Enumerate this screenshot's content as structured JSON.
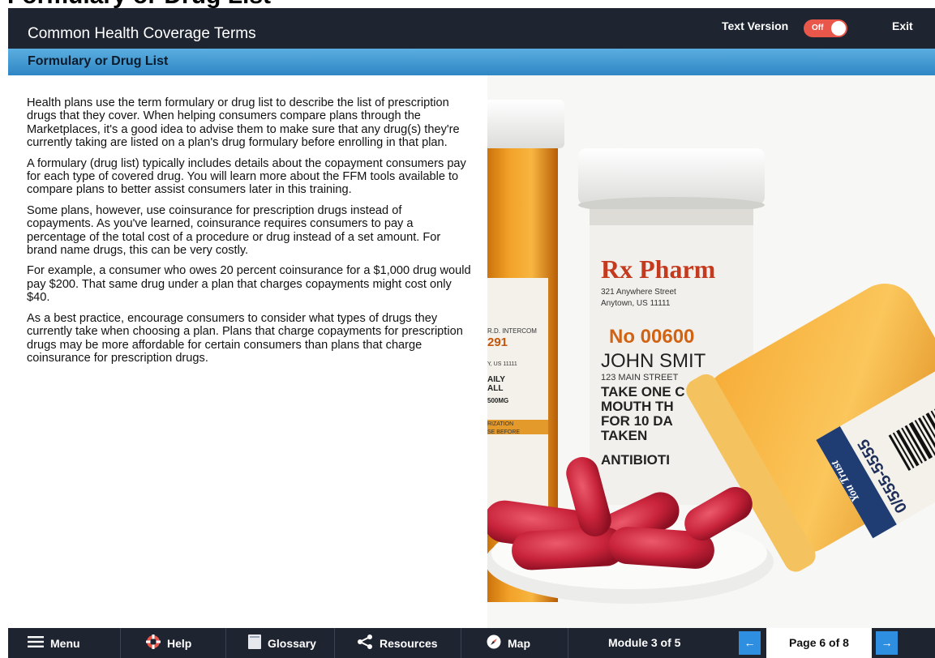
{
  "page_heading": "Formulary or Drug List",
  "header": {
    "title": "Common Health Coverage Terms",
    "text_version_label": "Text Version",
    "toggle_state": "Off",
    "exit_label": "Exit"
  },
  "subheader": {
    "title": "Formulary or Drug List"
  },
  "body": {
    "paragraphs": [
      "Health plans use the term formulary or drug list to describe the list of prescription drugs that they cover. When helping consumers compare plans through the Marketplaces, it's a good idea to advise them to make sure that any drug(s) they're currently taking are listed on a plan's drug formulary before enrolling in that plan.",
      "A formulary (drug list) typically includes details about the copayment consumers pay for each type of covered drug. You will learn more about the FFM tools available to compare plans to better assist consumers later in this training.",
      "Some plans, however, use coinsurance for prescription drugs instead of copayments. As you've learned, coinsurance requires consumers to pay a percentage of the total cost of a procedure or drug instead of a set amount. For brand name drugs, this can be very costly.",
      "For example, a consumer who owes 20 percent coinsurance for a $1,000 drug would pay $200. That same drug under a plan that charges copayments might cost only $40.",
      "As a best practice, encourage consumers to consider what types of drugs they currently take when choosing a plan. Plans that charge copayments for prescription drugs may be more affordable for certain consumers than plans that charge coinsurance for prescription drugs."
    ]
  },
  "photo": {
    "label_brand": "Rx Pharm",
    "label_address_1": "321 Anywhere Street",
    "label_address_2": "Anytown, US 11111",
    "label_rx_no": "No 00600",
    "label_patient": "JOHN SMIT",
    "label_patient_address": "123 MAIN STREET",
    "label_instructions_1": "TAKE ONE C",
    "label_instructions_2": "MOUTH TH",
    "label_instructions_3": "FOR 10 DA",
    "label_instructions_4": "TAKEN",
    "label_warning": "ANTIBIOTI",
    "left_label_1": "R.D. INTERCOM",
    "left_label_2": "291",
    "left_label_3": "Y, US 11111",
    "left_label_4": "AILY",
    "left_label_5": "ALL",
    "left_label_6": "500MG",
    "left_label_7": "RIZATION",
    "left_label_8": "SE BEFORE",
    "tipped_phone": "0/555-5555",
    "tipped_slogan": "You Trust"
  },
  "footer": {
    "menu": "Menu",
    "help": "Help",
    "glossary": "Glossary",
    "resources": "Resources",
    "map": "Map",
    "module": "Module 3 of 5",
    "page": "Page 6 of 8",
    "prev": "←",
    "next": "→"
  },
  "colors": {
    "header_bg": "#1e2430",
    "subheader_bg": "#3b95d2",
    "toggle_bg": "#e8574a",
    "nav_arrow_bg": "#2e8fe0"
  },
  "icons": {
    "menu": "hamburger-icon",
    "help": "lifebuoy-icon",
    "glossary": "book-icon",
    "resources": "share-icon",
    "map": "compass-icon"
  }
}
